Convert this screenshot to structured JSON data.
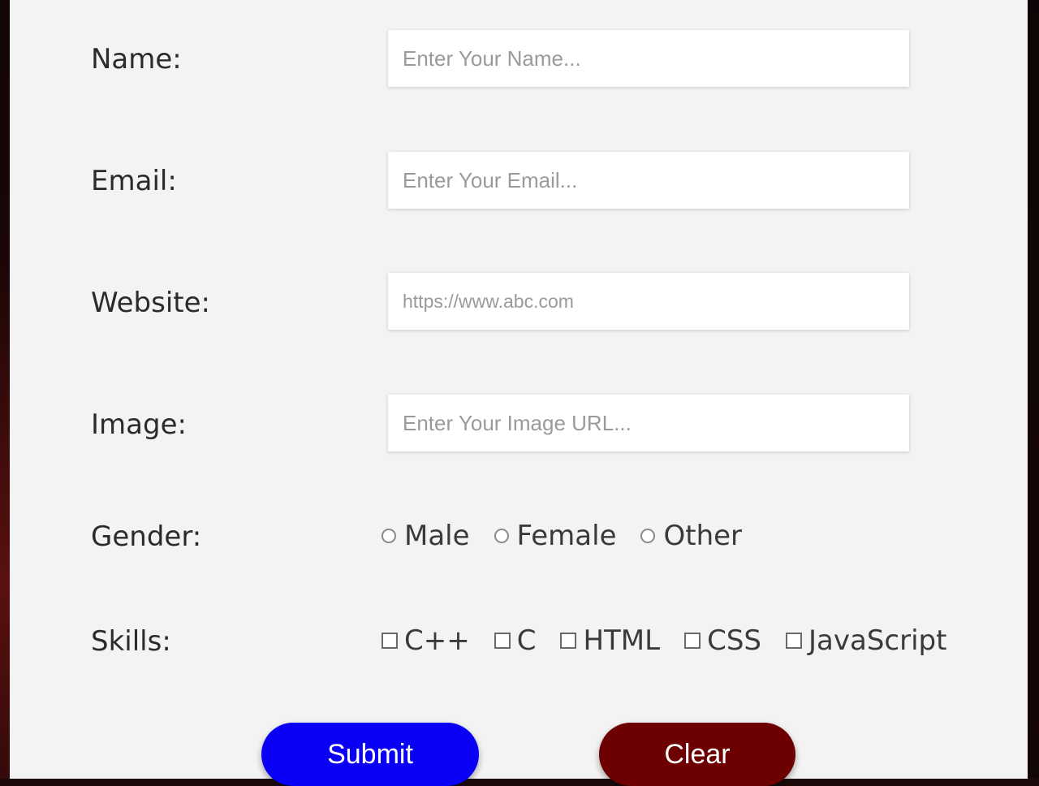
{
  "form": {
    "name": {
      "label": "Name:",
      "placeholder": "Enter Your Name..."
    },
    "email": {
      "label": "Email:",
      "placeholder": "Enter Your Email..."
    },
    "website": {
      "label": "Website:",
      "placeholder": "https://www.abc.com"
    },
    "image": {
      "label": "Image:",
      "placeholder": "Enter Your Image URL..."
    },
    "gender": {
      "label": "Gender:",
      "options": [
        "Male",
        "Female",
        "Other"
      ]
    },
    "skills": {
      "label": "Skills:",
      "options": [
        "C++",
        "C",
        "HTML",
        "CSS",
        "JavaScript"
      ]
    }
  },
  "buttons": {
    "submit": "Submit",
    "clear": "Clear",
    "submit_color": "#0a00f5",
    "clear_color": "#6d0000"
  }
}
